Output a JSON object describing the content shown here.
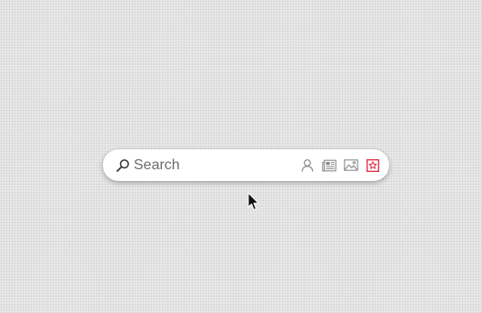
{
  "search": {
    "placeholder": "Search",
    "value": ""
  },
  "scopes": [
    {
      "icon": "person-icon",
      "color": "#8a8a8a",
      "selected": false
    },
    {
      "icon": "newspaper-icon",
      "color": "#8a8a8a",
      "selected": false
    },
    {
      "icon": "image-icon",
      "color": "#8a8a8a",
      "selected": false
    },
    {
      "icon": "favorite-star-icon",
      "color": "#d9293b",
      "selected": true
    }
  ],
  "colors": {
    "background": "#e4e4e4",
    "bar": "#ffffff",
    "placeholder": "#6b6b6b",
    "accent": "#d9293b"
  }
}
